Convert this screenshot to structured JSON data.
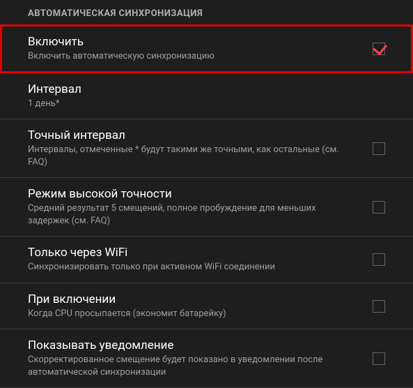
{
  "section_header": "АВТОМАТИЧЕСКАЯ СИНХРОНИЗАЦИЯ",
  "items": [
    {
      "title": "Включить",
      "subtitle": "Включить автоматическую синхронизацию",
      "checked": true,
      "has_checkbox": true,
      "highlighted": true
    },
    {
      "title": "Интервал",
      "subtitle": "1 день*",
      "has_checkbox": false
    },
    {
      "title": "Точный интервал",
      "subtitle": "Интервалы, отмеченные * будут такими же точными, как остальные (см. FAQ)",
      "checked": false,
      "has_checkbox": true
    },
    {
      "title": "Режим высокой точности",
      "subtitle": "Средний результат 5 смещений, полное пробуждение для меньших задержек (см. FAQ)",
      "checked": false,
      "has_checkbox": true
    },
    {
      "title": "Только через WiFi",
      "subtitle": "Синхронизировать только при активном WiFi соединении",
      "checked": false,
      "has_checkbox": true
    },
    {
      "title": "При включении",
      "subtitle": "Когда CPU просыпается (экономит батарейку)",
      "checked": false,
      "has_checkbox": true
    },
    {
      "title": "Показывать уведомление",
      "subtitle": "Скорректированное смещение будет показано в уведомлении после автоматической синхронизации",
      "checked": false,
      "has_checkbox": true
    }
  ]
}
